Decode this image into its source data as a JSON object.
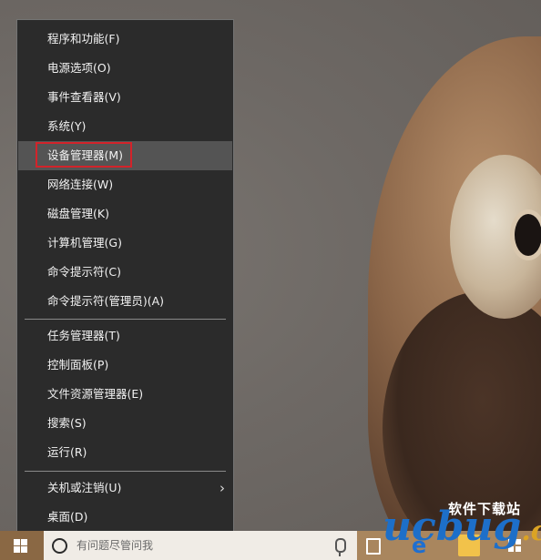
{
  "context_menu": {
    "items": [
      {
        "label": "程序和功能(F)"
      },
      {
        "label": "电源选项(O)"
      },
      {
        "label": "事件查看器(V)"
      },
      {
        "label": "系统(Y)"
      },
      {
        "label": "设备管理器(M)",
        "hovered": true,
        "highlighted": true
      },
      {
        "label": "网络连接(W)"
      },
      {
        "label": "磁盘管理(K)"
      },
      {
        "label": "计算机管理(G)"
      },
      {
        "label": "命令提示符(C)"
      },
      {
        "label": "命令提示符(管理员)(A)"
      },
      {
        "label": "任务管理器(T)"
      },
      {
        "label": "控制面板(P)"
      },
      {
        "label": "文件资源管理器(E)"
      },
      {
        "label": "搜索(S)"
      },
      {
        "label": "运行(R)"
      },
      {
        "label": "关机或注销(U)",
        "has_submenu": true
      },
      {
        "label": "桌面(D)"
      }
    ]
  },
  "taskbar": {
    "search_placeholder": "有问题尽管问我",
    "icons": [
      "windows-start-icon",
      "cortana-icon",
      "microphone-icon",
      "task-view-icon",
      "edge-icon",
      "file-explorer-icon",
      "store-icon"
    ]
  },
  "watermark": {
    "top_text": "软件下载站",
    "brand": "ucbug",
    "suffix": ".cc"
  },
  "colors": {
    "menu_bg": "#2b2b2b",
    "menu_hover": "#545454",
    "highlight_border": "#d3232a",
    "taskbar": "#a9865e"
  }
}
